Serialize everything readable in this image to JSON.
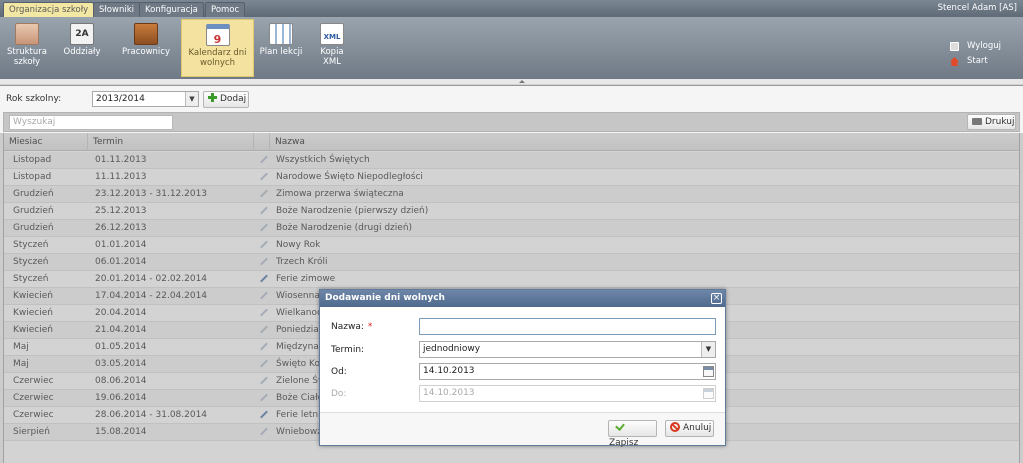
{
  "menu_tabs": [
    {
      "label": "Organizacja szkoły",
      "active": true
    },
    {
      "label": "Słowniki",
      "active": false
    },
    {
      "label": "Konfiguracja",
      "active": false
    },
    {
      "label": "Pomoc",
      "active": false
    }
  ],
  "user": "Stencel Adam [AS]",
  "ribbon": [
    {
      "label": "Struktura szkoły",
      "icon": "school-structure-icon"
    },
    {
      "label": "Oddziały",
      "icon": "class-2a-icon"
    },
    {
      "label": "Pracownicy",
      "icon": "briefcase-icon"
    },
    {
      "label": "Kalendarz dni wolnych",
      "icon": "calendar-icon",
      "active": true
    },
    {
      "label": "Plan lekcji",
      "icon": "timetable-icon"
    },
    {
      "label": "Kopia XML",
      "icon": "xml-file-icon"
    }
  ],
  "calendar_icon_number": "9",
  "class_icon_text": "2A",
  "xml_icon_text": "XML",
  "actions": {
    "logout": "Wyloguj",
    "start": "Start"
  },
  "filter": {
    "label": "Rok szkolny:",
    "value": "2013/2014",
    "add_button": "Dodaj"
  },
  "search": {
    "placeholder": "Wyszukaj"
  },
  "print_button": "Drukuj",
  "columns": {
    "month": "Miesiac",
    "term": "Termin",
    "name": "Nazwa"
  },
  "rows": [
    {
      "month": "Listopad",
      "term": "01.11.2013",
      "name": "Wszystkich Świętych"
    },
    {
      "month": "Listopad",
      "term": "11.11.2013",
      "name": "Narodowe Święto Niepodległości"
    },
    {
      "month": "Grudzień",
      "term": "23.12.2013 - 31.12.2013",
      "name": "Zimowa przerwa świąteczna"
    },
    {
      "month": "Grudzień",
      "term": "25.12.2013",
      "name": "Boże Narodzenie (pierwszy dzień)"
    },
    {
      "month": "Grudzień",
      "term": "26.12.2013",
      "name": "Boże Narodzenie (drugi dzień)"
    },
    {
      "month": "Styczeń",
      "term": "01.01.2014",
      "name": "Nowy Rok"
    },
    {
      "month": "Styczeń",
      "term": "06.01.2014",
      "name": "Trzech Króli"
    },
    {
      "month": "Styczeń",
      "term": "20.01.2014 - 02.02.2014",
      "name": "Ferie zimowe"
    },
    {
      "month": "Kwiecień",
      "term": "17.04.2014 - 22.04.2014",
      "name": "Wiosenna p"
    },
    {
      "month": "Kwiecień",
      "term": "20.04.2014",
      "name": "Wielkanoc"
    },
    {
      "month": "Kwiecień",
      "term": "21.04.2014",
      "name": "Poniedziałe"
    },
    {
      "month": "Maj",
      "term": "01.05.2014",
      "name": "Międzynaro"
    },
    {
      "month": "Maj",
      "term": "03.05.2014",
      "name": "Święto Kons"
    },
    {
      "month": "Czerwiec",
      "term": "08.06.2014",
      "name": "Zielone Świ"
    },
    {
      "month": "Czerwiec",
      "term": "19.06.2014",
      "name": "Boże Ciało"
    },
    {
      "month": "Czerwiec",
      "term": "28.06.2014 - 31.08.2014",
      "name": "Ferie letnie"
    },
    {
      "month": "Sierpień",
      "term": "15.08.2014",
      "name": "Wniebowzię"
    }
  ],
  "dialog": {
    "title": "Dodawanie dni wolnych",
    "close": "×",
    "name_label": "Nazwa:",
    "required_mark": "*",
    "name_value": "",
    "term_label": "Termin:",
    "term_value": "jednodniowy",
    "from_label": "Od:",
    "from_value": "14.10.2013",
    "to_label": "Do:",
    "to_value": "14.10.2013",
    "save": "Zapisz",
    "cancel": "Anuluj"
  }
}
